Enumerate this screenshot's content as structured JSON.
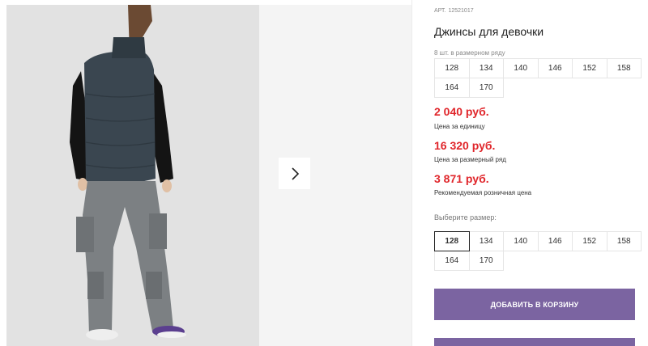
{
  "product": {
    "sku_label": "АРТ.",
    "sku_value": "12521017",
    "title": "Джинсы для девочки"
  },
  "size_row": {
    "note": "8 шт. в размерном ряду",
    "sizes": [
      "128",
      "134",
      "140",
      "146",
      "152",
      "158",
      "164",
      "170"
    ]
  },
  "prices": {
    "unit_price": "2 040 руб.",
    "unit_label": "Цена за единицу",
    "row_price": "16 320 руб.",
    "row_label": "Цена за размерный ряд",
    "retail_price": "3 871 руб.",
    "retail_label": "Рекомендуемая розничная цена"
  },
  "size_picker": {
    "label": "Выберите размер:",
    "sizes": [
      "128",
      "134",
      "140",
      "146",
      "152",
      "158",
      "164",
      "170"
    ],
    "selected": "128"
  },
  "actions": {
    "add_to_cart": "ДОБАВИТЬ В КОРЗИНУ"
  },
  "gallery": {
    "next_icon": "chevron-right-icon"
  },
  "colors": {
    "price": "#e0262b",
    "button": "#7b64a1"
  }
}
